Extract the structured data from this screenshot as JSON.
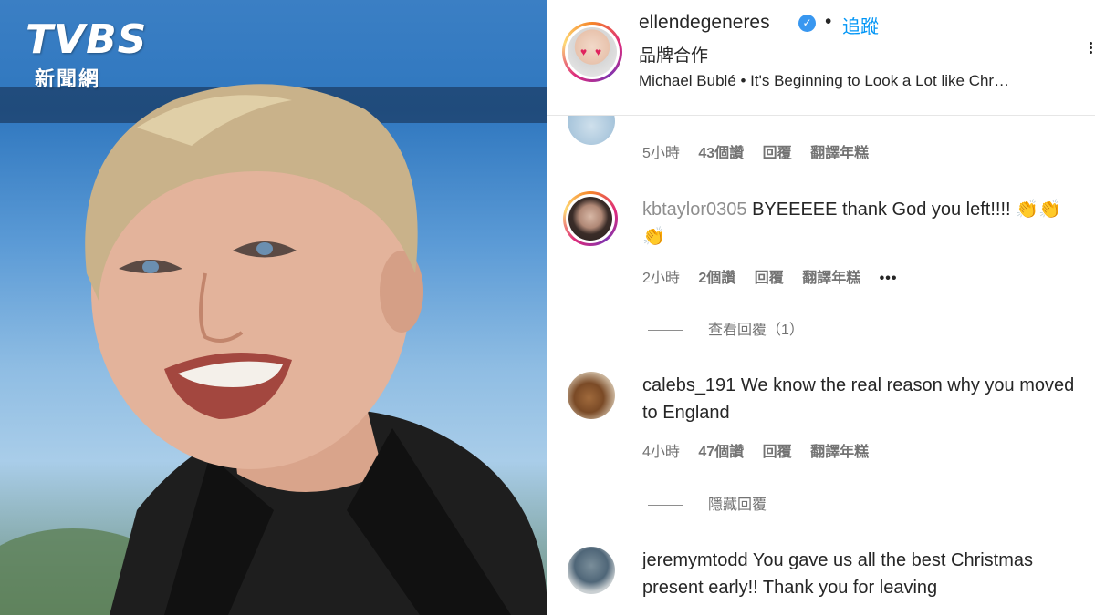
{
  "watermark": {
    "logo_text": "TVBS",
    "logo_sub": "新聞網"
  },
  "post": {
    "username": "ellendegeneres",
    "separator": "•",
    "follow_label": "追蹤",
    "partnership_label": "品牌合作",
    "music": "Michael Bublé • It's Beginning to Look a Lot like Chr…"
  },
  "comments": [
    {
      "username": "",
      "text": "",
      "time": "5小時",
      "likes": "43個讚",
      "reply_label": "回覆",
      "translate_label": "翻譯年糕"
    },
    {
      "username": "kbtaylor0305",
      "text": "BYEEEEE thank God you left!!!! 👏👏👏",
      "time": "2小時",
      "likes": "2個讚",
      "reply_label": "回覆",
      "translate_label": "翻譯年糕",
      "more": "•••",
      "view_replies": "查看回覆（1）"
    },
    {
      "username": "calebs_191",
      "text": "We know the real reason why you moved to England",
      "time": "4小時",
      "likes": "47個讚",
      "reply_label": "回覆",
      "translate_label": "翻譯年糕",
      "hide_replies": "隱藏回覆"
    },
    {
      "username": "jeremymtodd",
      "text": "You gave us all the best Christmas present early!! Thank you for leaving"
    }
  ],
  "colors": {
    "link_blue": "#0095f6",
    "verified_blue": "#3897f0",
    "meta_gray": "#737373"
  },
  "icons": {
    "verified": "verified-badge-icon",
    "more": "more-options-icon"
  }
}
